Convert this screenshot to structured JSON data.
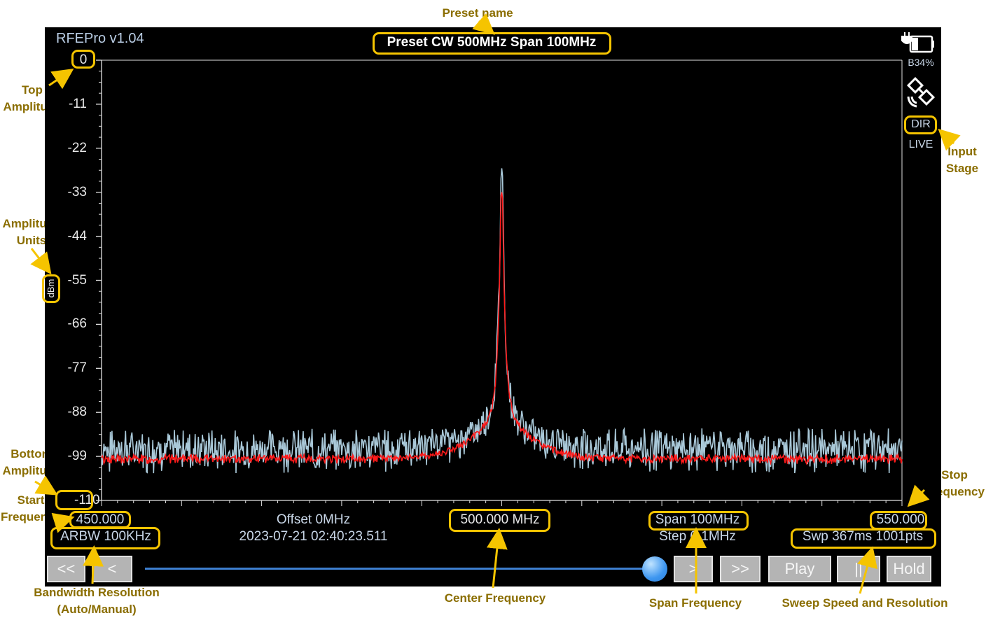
{
  "app": {
    "title": "RFEPro v1.04",
    "preset_name": "Preset CW 500MHz Span 100MHz"
  },
  "status": {
    "battery": "B34%",
    "input_stage": "DIR",
    "mode": "LIVE",
    "colors": {
      "accent": "#f5c400",
      "trace_live": "#a9c8d8",
      "trace_avg": "#ff1a1a"
    }
  },
  "axis": {
    "units": "dBm",
    "y_ticks": [
      "0",
      "-11",
      "-22",
      "-33",
      "-44",
      "-55",
      "-66",
      "-77",
      "-88",
      "-99",
      "-110"
    ],
    "start_freq": "450.000",
    "stop_freq": "550.000",
    "center_freq": "500.000 MHz"
  },
  "info": {
    "rbw": "ARBW 100KHz",
    "offset": "Offset 0MHz",
    "timestamp": "2023-07-21 02:40:23.511",
    "span": "Span 100MHz",
    "step": "Step 0.1MHz",
    "sweep": "Swp 367ms  1001pts"
  },
  "controls": {
    "first": "<<",
    "prev": "<",
    "next": ">",
    "last": ">>",
    "play": "Play",
    "pause": "||",
    "hold": "Hold",
    "slider_level": 1.0
  },
  "callouts": {
    "preset_name": "Preset name",
    "top_amplitude": [
      "Top",
      "Amplitude"
    ],
    "amplitude_units": [
      "Amplitude",
      "Units"
    ],
    "bottom_amplitude": [
      "Bottom",
      "Amplitude"
    ],
    "start_frequency": [
      "Start",
      "Frequency"
    ],
    "input_stage": [
      "Input",
      "Stage"
    ],
    "stop_frequency": [
      "Stop",
      "Frequency"
    ],
    "bandwidth_resolution": [
      "Bandwidth Resolution",
      "(Auto/Manual)"
    ],
    "center_frequency": "Center Frequency",
    "span_frequency": "Span Frequency",
    "sweep_speed": "Sweep Speed and Resolution"
  },
  "chart_data": {
    "type": "line",
    "xlabel": "",
    "ylabel": "dBm",
    "xlim": [
      450,
      550
    ],
    "ylim": [
      -110,
      0
    ],
    "grid": false,
    "peak": {
      "x": 500.0,
      "y": -27
    },
    "series": [
      {
        "noise_floor": -99,
        "peak_x": 500.0,
        "peak_y": -27
      },
      {
        "noise_floor": -100,
        "peak_x": 500.0,
        "peak_y": -33
      }
    ]
  }
}
